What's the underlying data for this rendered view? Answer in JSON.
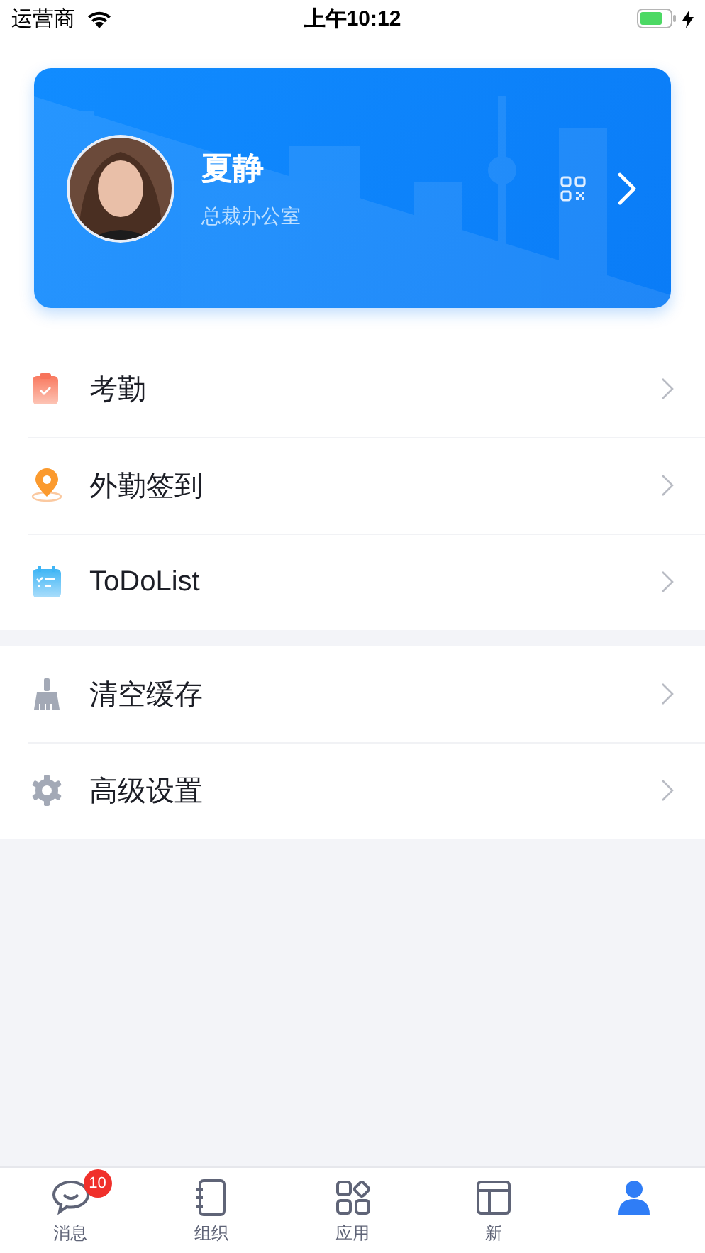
{
  "status_bar": {
    "carrier": "运营商",
    "time": "上午10:12"
  },
  "profile": {
    "name": "夏静",
    "department": "总裁办公室"
  },
  "menu_groups": [
    {
      "items": [
        {
          "label": "考勤",
          "kind": "clipboard"
        },
        {
          "label": "外勤签到",
          "kind": "pin"
        },
        {
          "label": "ToDoList",
          "kind": "calendar"
        }
      ]
    },
    {
      "items": [
        {
          "label": "清空缓存",
          "kind": "broom"
        },
        {
          "label": "高级设置",
          "kind": "gear"
        }
      ]
    }
  ],
  "tab_bar": [
    {
      "label": "消息",
      "kind": "chat",
      "badge": "10",
      "selected": false
    },
    {
      "label": "组织",
      "kind": "notebook",
      "selected": false
    },
    {
      "label": "应用",
      "kind": "apps",
      "selected": false
    },
    {
      "label": "新",
      "kind": "window",
      "selected": false
    },
    {
      "kind": "person",
      "selected": true
    }
  ]
}
